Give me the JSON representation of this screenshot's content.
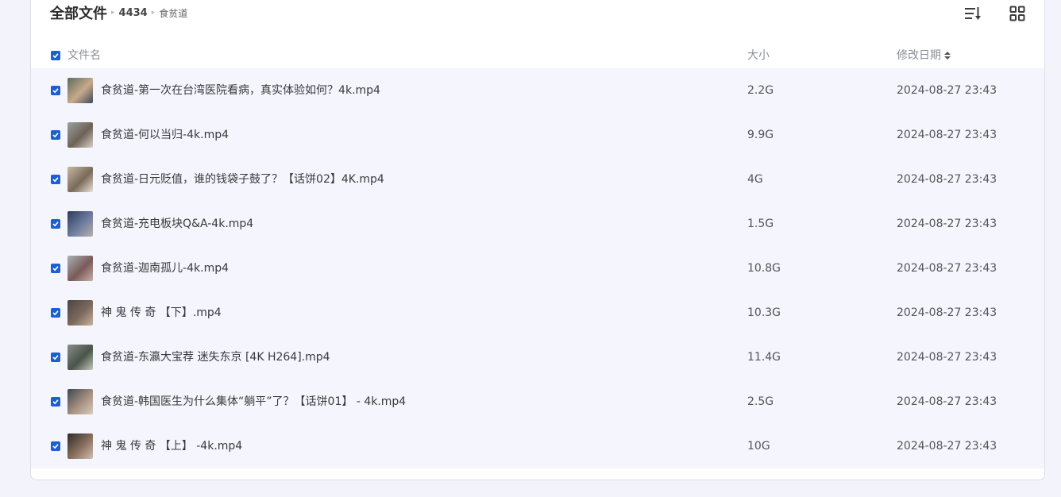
{
  "breadcrumb": {
    "root": "全部文件",
    "sep1": "▸",
    "middle": "4434",
    "sep2": "▸",
    "current": "食贫道"
  },
  "toolbar": {
    "sort_icon": "sort-list-icon",
    "view_icon": "grid-view-icon"
  },
  "table": {
    "headers": {
      "name": "文件名",
      "size": "大小",
      "modified": "修改日期",
      "sort_arrow": "⬍"
    },
    "rows": [
      {
        "name": "食贫道-第一次在台湾医院看病，真实体验如何？4k.mp4",
        "size": "2.2G",
        "date": "2024-08-27 23:43"
      },
      {
        "name": "食贫道-何以当归-4k.mp4",
        "size": "9.9G",
        "date": "2024-08-27 23:43"
      },
      {
        "name": "食贫道-日元贬值，谁的钱袋子鼓了？【话饼02】4K.mp4",
        "size": "4G",
        "date": "2024-08-27 23:43"
      },
      {
        "name": "食贫道-充电板块Q&A-4k.mp4",
        "size": "1.5G",
        "date": "2024-08-27 23:43"
      },
      {
        "name": "食贫道-迦南孤儿-4k.mp4",
        "size": "10.8G",
        "date": "2024-08-27 23:43"
      },
      {
        "name": "神 鬼 传 奇 【下】.mp4",
        "size": "10.3G",
        "date": "2024-08-27 23:43"
      },
      {
        "name": "食贫道-东瀛大宝荐 迷失东京 [4K H264].mp4",
        "size": "11.4G",
        "date": "2024-08-27 23:43"
      },
      {
        "name": "食贫道-韩国医生为什么集体“躺平”了？【话饼01】 - 4k.mp4",
        "size": "2.5G",
        "date": "2024-08-27 23:43"
      },
      {
        "name": "神 鬼 传 奇 【上】 -4k.mp4",
        "size": "10G",
        "date": "2024-08-27 23:43"
      }
    ]
  },
  "colors": {
    "accent": "#1b5fd1",
    "row_bg": "#f4f5fd",
    "page_bg": "#f2f3fb"
  }
}
